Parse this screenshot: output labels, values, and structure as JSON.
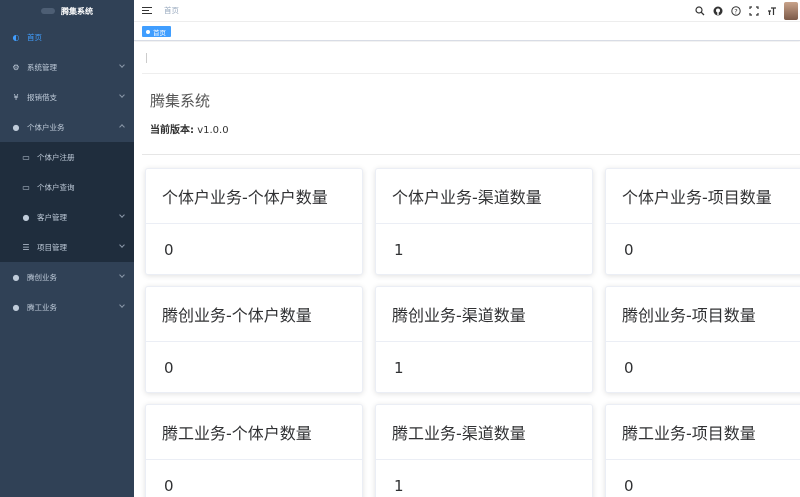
{
  "sidebar": {
    "logo_text": "腾集系统",
    "items": [
      {
        "label": "首页",
        "icon": "dashboard-icon",
        "glyph": "◐"
      },
      {
        "label": "系统管理",
        "icon": "gear-icon",
        "glyph": "⚙"
      },
      {
        "label": "报销借支",
        "icon": "yen-icon",
        "glyph": "¥"
      },
      {
        "label": "个体户业务",
        "icon": "user-icon",
        "glyph": "●"
      }
    ],
    "submenu": [
      {
        "label": "个体户注册",
        "icon": "monitor-icon",
        "glyph": "▭"
      },
      {
        "label": "个体户查询",
        "icon": "monitor-icon",
        "glyph": "▭"
      },
      {
        "label": "客户管理",
        "icon": "peoples-icon",
        "glyph": "●"
      },
      {
        "label": "项目管理",
        "icon": "list-icon",
        "glyph": "☰"
      }
    ],
    "bottom_items": [
      {
        "label": "腾创业务",
        "icon": "user-icon",
        "glyph": "●"
      },
      {
        "label": "腾工业务",
        "icon": "user-icon",
        "glyph": "●"
      }
    ]
  },
  "navbar": {
    "breadcrumb": "首页",
    "icons": [
      "search-icon",
      "github-icon",
      "question-icon",
      "fullscreen-icon",
      "font-size-icon"
    ]
  },
  "tags": {
    "active_tag": "首页"
  },
  "main": {
    "system_title": "腾集系统",
    "version_label": "当前版本:",
    "version_value": "v1.0.0"
  },
  "cards": [
    {
      "title": "个体户业务-个体户数量",
      "value": "0"
    },
    {
      "title": "个体户业务-渠道数量",
      "value": "1"
    },
    {
      "title": "个体户业务-项目数量",
      "value": "0"
    },
    {
      "title": "腾创业务-个体户数量",
      "value": "0"
    },
    {
      "title": "腾创业务-渠道数量",
      "value": "1"
    },
    {
      "title": "腾创业务-项目数量",
      "value": "0"
    },
    {
      "title": "腾工业务-个体户数量",
      "value": "0"
    },
    {
      "title": "腾工业务-渠道数量",
      "value": "1"
    },
    {
      "title": "腾工业务-项目数量",
      "value": "0"
    }
  ],
  "colors": {
    "sidebar_bg": "#304156",
    "submenu_bg": "#1f2d3d",
    "accent": "#409eff"
  }
}
